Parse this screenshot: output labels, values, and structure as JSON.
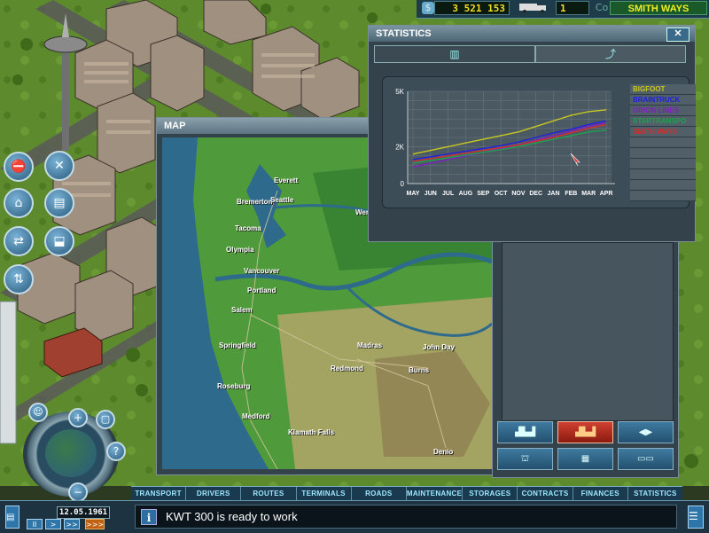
{
  "hud": {
    "money": "3 521 153",
    "trucks": "1",
    "company": "SMITH WAYS",
    "money_icon": "dollar-icon",
    "truck_icon": "truck-icon",
    "company_icon": "company-icon"
  },
  "map_window": {
    "title": "MAP",
    "cities": [
      "Everett",
      "Bremerton",
      "Seattle",
      "Tacoma",
      "Olympia",
      "Vancouver",
      "Portland",
      "Salem",
      "Springfield",
      "Roseburg",
      "Medford",
      "Klamath Falls",
      "Redmond",
      "Madras",
      "John Day",
      "Burns",
      "Denio",
      "Wen"
    ]
  },
  "stats_window": {
    "title": "STATISTICS",
    "close_label": "✕",
    "tab_bar_icon": "bar-chart-icon",
    "tab_line_icon": "line-chart-icon",
    "cursor_icon": "pointer-cursor-icon"
  },
  "chart_data": {
    "type": "line",
    "categories": [
      "MAY",
      "JUN",
      "JUL",
      "AUG",
      "SEP",
      "OCT",
      "NOV",
      "DEC",
      "JAN",
      "FEB",
      "MAR",
      "APR"
    ],
    "yticks": [
      "0",
      "2K",
      "5K"
    ],
    "ylim": [
      0,
      5000
    ],
    "series": [
      {
        "name": "BIGFOOT",
        "color": "#c8c820",
        "values": [
          1600,
          1800,
          2000,
          2200,
          2400,
          2600,
          2800,
          3100,
          3400,
          3700,
          3900,
          4000
        ]
      },
      {
        "name": "BRAINTRUCK",
        "color": "#2020e0",
        "values": [
          1300,
          1450,
          1600,
          1750,
          1900,
          2050,
          2250,
          2500,
          2750,
          2950,
          3200,
          3400
        ]
      },
      {
        "name": "ORION LINES",
        "color": "#8020c0",
        "values": [
          900,
          1100,
          1300,
          1500,
          1700,
          1900,
          2100,
          2350,
          2600,
          2850,
          3100,
          3300
        ]
      },
      {
        "name": "STARTRANSPO",
        "color": "#20a050",
        "values": [
          1100,
          1250,
          1400,
          1550,
          1700,
          1850,
          2000,
          2200,
          2400,
          2600,
          2800,
          2900
        ]
      },
      {
        "name": "SMITH WAYS",
        "color": "#d03030",
        "values": [
          1200,
          1350,
          1500,
          1650,
          1800,
          1950,
          2100,
          2300,
          2500,
          2750,
          3000,
          3200
        ]
      }
    ],
    "legend_rows": 11,
    "grid": true
  },
  "left_menu": {
    "buttons": [
      {
        "icon": "road-tool-icon"
      },
      {
        "icon": "wrench-tools-icon"
      },
      {
        "icon": "terminal-icon"
      },
      {
        "icon": "factory-icon"
      },
      {
        "icon": "route-icon"
      },
      {
        "icon": "warehouse-icon"
      },
      {
        "icon": "arrows-icon"
      }
    ]
  },
  "minimap": {
    "zoom_in": "+",
    "zoom_out": "−",
    "help": "?"
  },
  "menu": [
    "TRANSPORT",
    "DRIVERS",
    "ROUTES",
    "TERMINALS",
    "ROADS",
    "MAINTENANCE",
    "STORAGES",
    "CONTRACTS",
    "FINANCES",
    "STATISTICS"
  ],
  "status": {
    "date": "12.05.1961",
    "message": "KWT 300 is ready to work",
    "info_icon": "i"
  },
  "speed": [
    "II",
    ">",
    ">>",
    ">>>"
  ],
  "right_buttons": [
    {
      "icon": "city-skyline-icon"
    },
    {
      "icon": "city-red-icon"
    },
    {
      "icon": "arrows-left-right-icon"
    },
    {
      "icon": "power-plant-icon"
    },
    {
      "icon": "factory-building-icon"
    },
    {
      "icon": "truck-trailer-icon"
    }
  ]
}
